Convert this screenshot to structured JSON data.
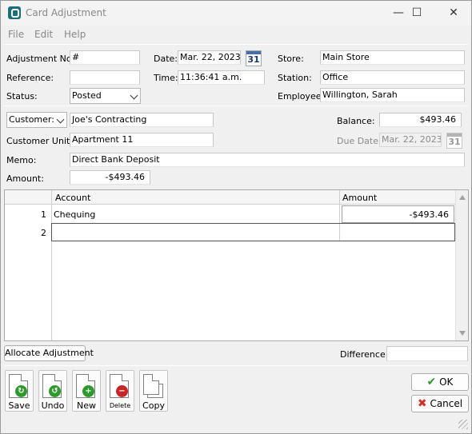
{
  "window": {
    "title": "Card Adjustment",
    "controls": {
      "minimize": "—",
      "maximize": "☐",
      "close": "✕"
    }
  },
  "menu": {
    "items": [
      "File",
      "Edit",
      "Help"
    ]
  },
  "header": {
    "adjustment_no_label": "Adjustment No.",
    "adjustment_no": "#",
    "reference_label": "Reference:",
    "reference": "",
    "status_label": "Status:",
    "status": "Posted",
    "date_label": "Date:",
    "date": "Mar. 22, 2023",
    "time_label": "Time:",
    "time": "11:36:41 a.m.",
    "calendar_day": "31",
    "store_label": "Store:",
    "store": "Main Store",
    "station_label": "Station:",
    "station": "Office",
    "employee_label": "Employee:",
    "employee": "Willington, Sarah"
  },
  "customer": {
    "type_select": "Customer:",
    "name": "Joe's Contracting",
    "unit_label": "Customer Unit:",
    "unit": "Apartment 11",
    "memo_label": "Memo:",
    "memo": "Direct Bank Deposit",
    "amount_label": "Amount:",
    "amount": "-$493.46",
    "balance_label": "Balance:",
    "balance": "$493.46",
    "due_date_label": "Due Date:",
    "due_date": "Mar. 22, 2023"
  },
  "grid": {
    "columns": [
      "Account",
      "Amount"
    ],
    "rows": [
      {
        "num": "1",
        "account": "Chequing",
        "amount": "-$493.46"
      },
      {
        "num": "2",
        "account": "",
        "amount": ""
      }
    ]
  },
  "footer": {
    "allocate_label": "Allocate Adjustment",
    "difference_label": "Difference:",
    "difference": "",
    "toolbar": {
      "save": "Save",
      "undo": "Undo",
      "new": "New",
      "delete": "Delete",
      "copy": "Copy"
    },
    "ok_label": "OK",
    "cancel_label": "Cancel"
  },
  "colors": {
    "save_green": "#2e9a2e",
    "new_green": "#2e9a2e",
    "delete_red": "#c62828",
    "ok_check": "#2e9a2e",
    "cancel_x": "#d32f2f"
  }
}
